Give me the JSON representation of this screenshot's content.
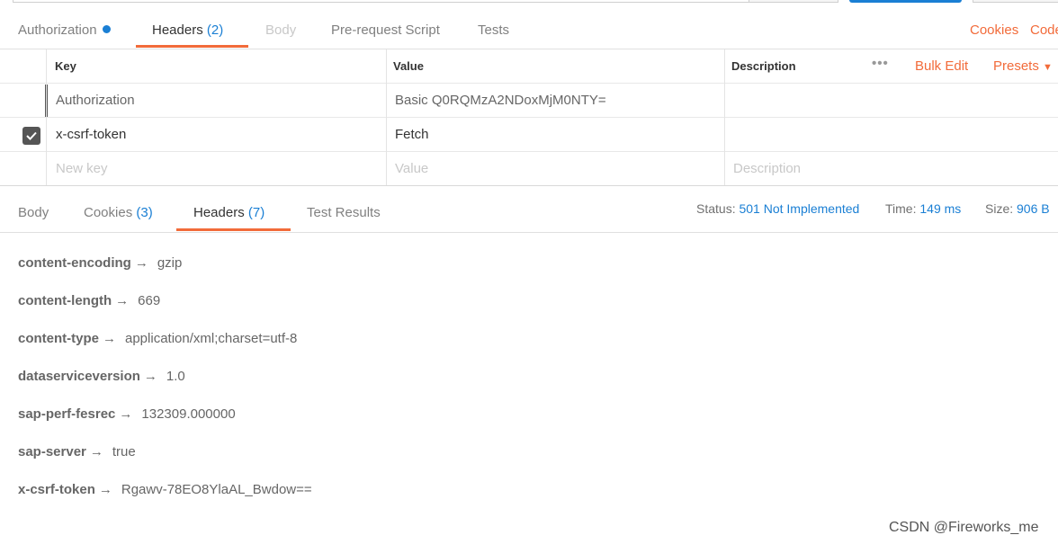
{
  "request_tabs": {
    "authorization": "Authorization",
    "headers": "Headers",
    "headers_count": "(2)",
    "body": "Body",
    "prerequest": "Pre-request Script",
    "tests": "Tests",
    "cookies_link": "Cookies",
    "code_link": "Code"
  },
  "headers_table": {
    "columns": {
      "key": "Key",
      "value": "Value",
      "description": "Description"
    },
    "bulk_edit": "Bulk Edit",
    "presets": "Presets",
    "rows": [
      {
        "key": "Authorization",
        "value": "Basic Q0RQMzA2NDoxMjM0NTY=",
        "checked": false
      },
      {
        "key": "x-csrf-token",
        "value": "Fetch",
        "checked": true
      }
    ],
    "new_row": {
      "key_placeholder": "New key",
      "value_placeholder": "Value",
      "description_placeholder": "Description"
    }
  },
  "response_tabs": {
    "body": "Body",
    "cookies": "Cookies",
    "cookies_count": "(3)",
    "headers": "Headers",
    "headers_count": "(7)",
    "test_results": "Test Results"
  },
  "response_meta": {
    "status_label": "Status:",
    "status_value": "501 Not Implemented",
    "time_label": "Time:",
    "time_value": "149 ms",
    "size_label": "Size:",
    "size_value": "906 B"
  },
  "response_headers": [
    {
      "key": "content-encoding",
      "value": "gzip"
    },
    {
      "key": "content-length",
      "value": "669"
    },
    {
      "key": "content-type",
      "value": "application/xml;charset=utf-8"
    },
    {
      "key": "dataserviceversion",
      "value": "1.0"
    },
    {
      "key": "sap-perf-fesrec",
      "value": "132309.000000"
    },
    {
      "key": "sap-server",
      "value": "true"
    },
    {
      "key": "x-csrf-token",
      "value": "Rgawv-78EO8YlaAL_Bwdow=="
    }
  ],
  "arrow_glyph": "→",
  "watermark": "CSDN @Fireworks_me",
  "colors": {
    "accent": "#f26b3a",
    "link": "#1a7fd4"
  }
}
